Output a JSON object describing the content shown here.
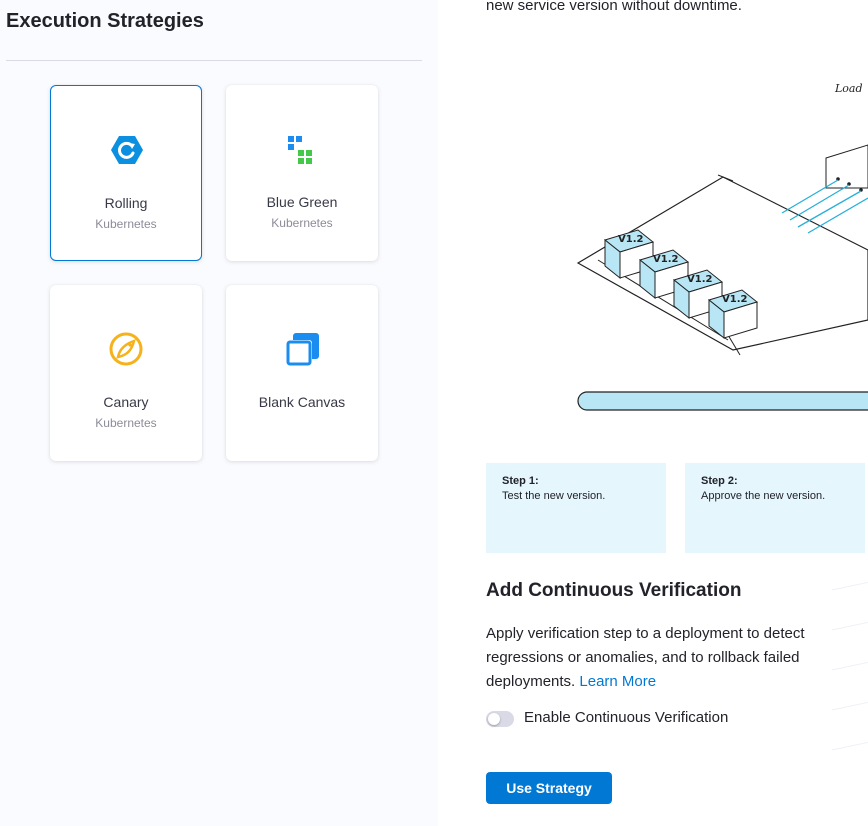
{
  "left_panel": {
    "title": "Execution Strategies",
    "cards": [
      {
        "label": "Rolling",
        "sub": "Kubernetes",
        "icon": "rolling-icon",
        "selected": true
      },
      {
        "label": "Blue Green",
        "sub": "Kubernetes",
        "icon": "blue-green-icon",
        "selected": false
      },
      {
        "label": "Canary",
        "sub": "Kubernetes",
        "icon": "canary-icon",
        "selected": false
      },
      {
        "label": "Blank Canvas",
        "sub": "",
        "icon": "blank-canvas-icon",
        "selected": false
      }
    ]
  },
  "right_panel": {
    "intro_text": "new service version without downtime.",
    "diagram": {
      "load_label": "Load",
      "version_labels": [
        "V1.2",
        "V1.2",
        "V1.2",
        "V1.2"
      ]
    },
    "steps": [
      {
        "title": "Step 1:",
        "text": "Test the new version."
      },
      {
        "title": "Step 2:",
        "text": "Approve the new version."
      }
    ],
    "cv": {
      "title": "Add Continuous Verification",
      "description": "Apply verification step to a deployment to detect regressions or anomalies, and to rollback failed deployments.",
      "learn_more": "Learn More",
      "toggle_label": "Enable Continuous Verification",
      "toggle_on": false
    },
    "use_strategy_label": "Use Strategy"
  },
  "colors": {
    "primary": "#0278d5",
    "rolling_icon": "#0b8fe0",
    "blue_green_blue": "#1b8df0",
    "blue_green_green": "#42c949",
    "canary_icon": "#f5b21b",
    "step_bg": "#e5f6fc",
    "diagram_accent": "#b8e6f5"
  }
}
